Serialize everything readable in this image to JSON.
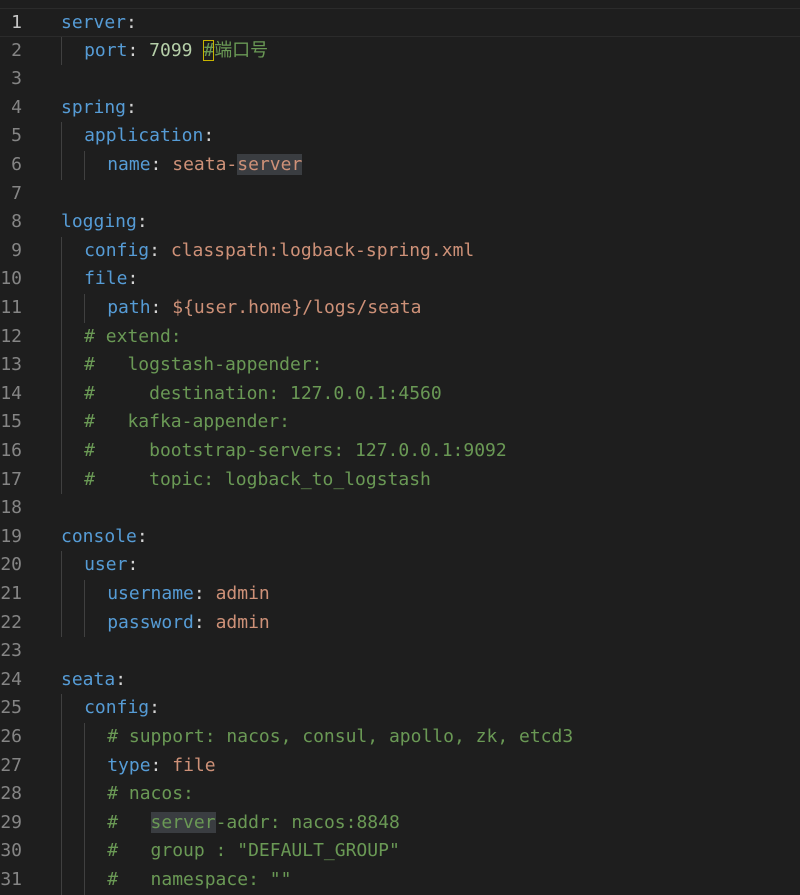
{
  "editor": {
    "lines": [
      {
        "n": "1",
        "t": [
          [
            "k",
            "server"
          ],
          [
            "p",
            ":"
          ]
        ]
      },
      {
        "n": "2",
        "t": [
          [
            "k",
            "port"
          ],
          [
            "p",
            ": "
          ],
          [
            "n",
            "7099"
          ],
          [
            "p",
            " "
          ],
          [
            "c",
            "#"
          ],
          [
            "c",
            "端口号"
          ]
        ]
      },
      {
        "n": "3",
        "t": []
      },
      {
        "n": "4",
        "t": [
          [
            "k",
            "spring"
          ],
          [
            "p",
            ":"
          ]
        ]
      },
      {
        "n": "5",
        "t": [
          [
            "k",
            "application"
          ],
          [
            "p",
            ":"
          ]
        ]
      },
      {
        "n": "6",
        "t": [
          [
            "k",
            "name"
          ],
          [
            "p",
            ": "
          ],
          [
            "s",
            "seata-"
          ],
          [
            "s",
            "server"
          ]
        ]
      },
      {
        "n": "7",
        "t": []
      },
      {
        "n": "8",
        "t": [
          [
            "k",
            "logging"
          ],
          [
            "p",
            ":"
          ]
        ]
      },
      {
        "n": "9",
        "t": [
          [
            "k",
            "config"
          ],
          [
            "p",
            ": "
          ],
          [
            "s",
            "classpath:logback-spring.xml"
          ]
        ]
      },
      {
        "n": "10",
        "t": [
          [
            "k",
            "file"
          ],
          [
            "p",
            ":"
          ]
        ]
      },
      {
        "n": "11",
        "t": [
          [
            "k",
            "path"
          ],
          [
            "p",
            ": "
          ],
          [
            "s",
            "${user.home}/logs/seata"
          ]
        ]
      },
      {
        "n": "12",
        "t": [
          [
            "c",
            "# extend:"
          ]
        ]
      },
      {
        "n": "13",
        "t": [
          [
            "c",
            "#   logstash-appender:"
          ]
        ]
      },
      {
        "n": "14",
        "t": [
          [
            "c",
            "#     destination: 127.0.0.1:4560"
          ]
        ]
      },
      {
        "n": "15",
        "t": [
          [
            "c",
            "#   kafka-appender:"
          ]
        ]
      },
      {
        "n": "16",
        "t": [
          [
            "c",
            "#     bootstrap-servers: 127.0.0.1:9092"
          ]
        ]
      },
      {
        "n": "17",
        "t": [
          [
            "c",
            "#     topic: logback_to_logstash"
          ]
        ]
      },
      {
        "n": "18",
        "t": []
      },
      {
        "n": "19",
        "t": [
          [
            "k",
            "console"
          ],
          [
            "p",
            ":"
          ]
        ]
      },
      {
        "n": "20",
        "t": [
          [
            "k",
            "user"
          ],
          [
            "p",
            ":"
          ]
        ]
      },
      {
        "n": "21",
        "t": [
          [
            "k",
            "username"
          ],
          [
            "p",
            ": "
          ],
          [
            "s",
            "admin"
          ]
        ]
      },
      {
        "n": "22",
        "t": [
          [
            "k",
            "password"
          ],
          [
            "p",
            ": "
          ],
          [
            "s",
            "admin"
          ]
        ]
      },
      {
        "n": "23",
        "t": []
      },
      {
        "n": "24",
        "t": [
          [
            "k",
            "seata"
          ],
          [
            "p",
            ":"
          ]
        ]
      },
      {
        "n": "25",
        "t": [
          [
            "k",
            "config"
          ],
          [
            "p",
            ":"
          ]
        ]
      },
      {
        "n": "26",
        "t": [
          [
            "c",
            "# support: nacos, consul, apollo, zk, etcd3"
          ]
        ]
      },
      {
        "n": "27",
        "t": [
          [
            "k",
            "type"
          ],
          [
            "p",
            ": "
          ],
          [
            "s",
            "file"
          ]
        ]
      },
      {
        "n": "28",
        "t": [
          [
            "c",
            "# nacos:"
          ]
        ]
      },
      {
        "n": "29",
        "t": [
          [
            "c",
            "#   "
          ],
          [
            "c",
            "server"
          ],
          [
            "c",
            "-addr: nacos:8848"
          ]
        ]
      },
      {
        "n": "30",
        "t": [
          [
            "c",
            "#   group : \"DEFAULT_GROUP\""
          ]
        ]
      },
      {
        "n": "31",
        "t": [
          [
            "c",
            "#   namespace: \"\""
          ]
        ]
      }
    ]
  }
}
